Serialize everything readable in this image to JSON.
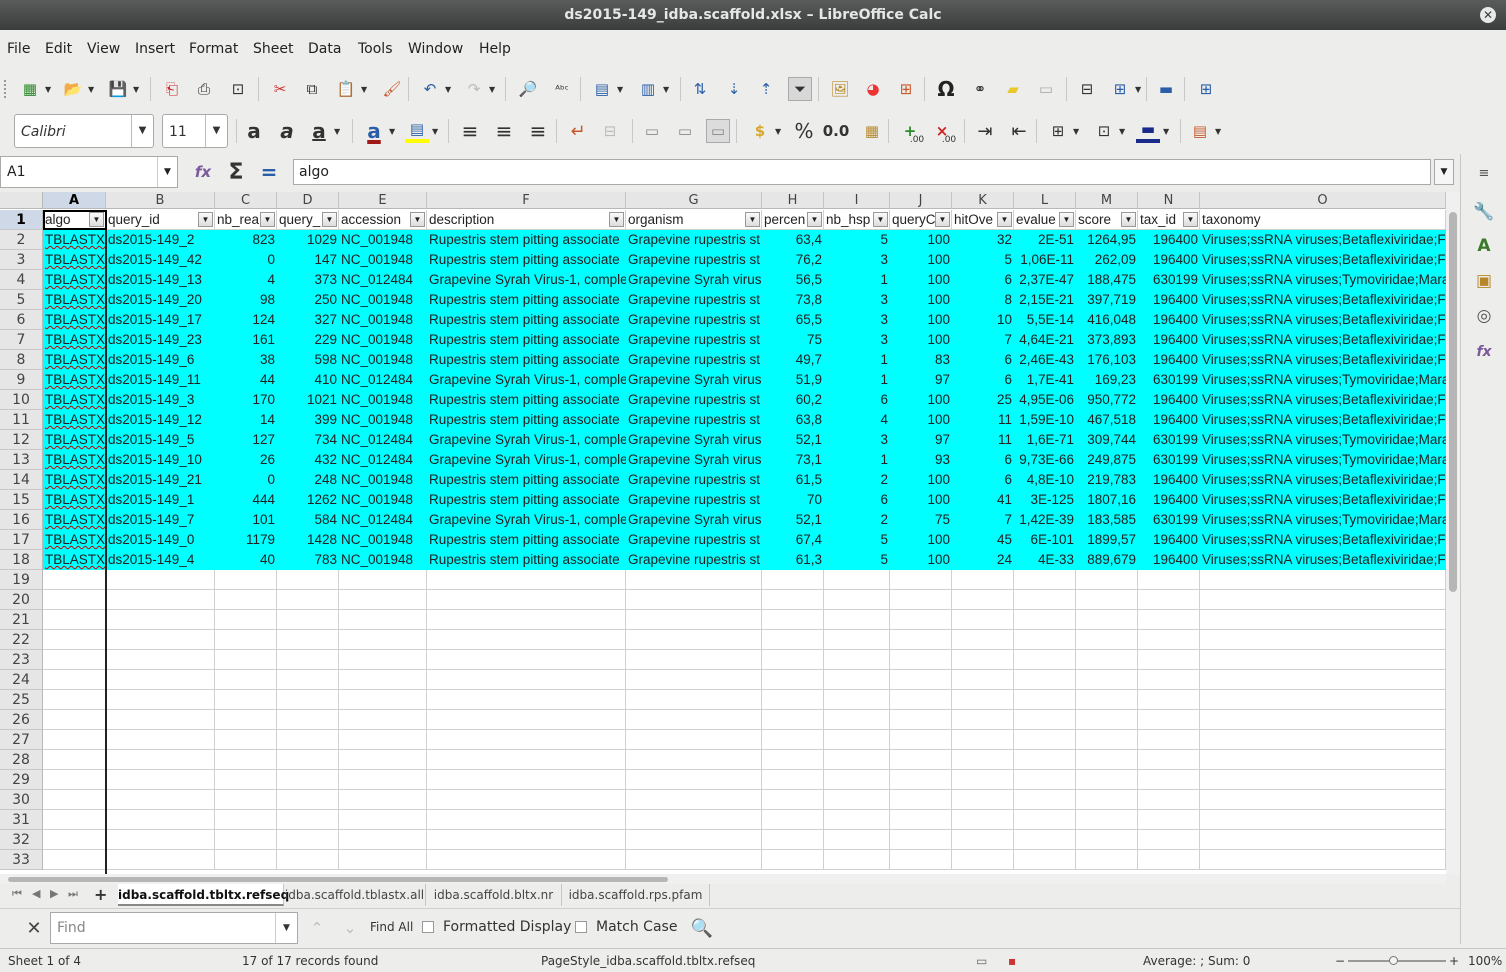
{
  "window": {
    "title": "ds2015-149_idba.scaffold.xlsx – LibreOffice Calc",
    "close_glyph": "✕"
  },
  "menu": [
    "File",
    "Edit",
    "View",
    "Insert",
    "Format",
    "Sheet",
    "Data",
    "Tools",
    "Window",
    "Help"
  ],
  "toolbar": {
    "font_name": "Calibri",
    "font_size": "11",
    "percent_label": "%",
    "number_label": "0.0",
    "omega_label": "Ω",
    "add_decimal_label": ".00",
    "remove_decimal_label": ".00"
  },
  "formula_bar": {
    "name_box": "A1",
    "content": "algo"
  },
  "sheet": {
    "column_letters": [
      "A",
      "B",
      "C",
      "D",
      "E",
      "F",
      "G",
      "H",
      "I",
      "J",
      "K",
      "L",
      "M",
      "N",
      "O"
    ],
    "headers": [
      "algo",
      "query_id",
      "nb_rea",
      "query_",
      "accession",
      "description",
      "organism",
      "percen",
      "nb_hsp",
      "queryC",
      "hitOve",
      "evalue",
      "score",
      "tax_id",
      "taxonomy"
    ],
    "rows": [
      [
        "TBLASTX",
        "ds2015-149_2",
        "823",
        "1029",
        "NC_001948",
        "Rupestris stem pitting associate",
        "Grapevine rupestris st",
        "63,4",
        "5",
        "100",
        "32",
        "2E-51",
        "1264,95",
        "196400",
        "Viruses;ssRNA viruses;Betaflexiviridae;Fo"
      ],
      [
        "TBLASTX",
        "ds2015-149_42",
        "0",
        "147",
        "NC_001948",
        "Rupestris stem pitting associate",
        "Grapevine rupestris st",
        "76,2",
        "3",
        "100",
        "5",
        "1,06E-11",
        "262,09",
        "196400",
        "Viruses;ssRNA viruses;Betaflexiviridae;Fo"
      ],
      [
        "TBLASTX",
        "ds2015-149_13",
        "4",
        "373",
        "NC_012484",
        "Grapevine Syrah Virus-1, comple",
        "Grapevine Syrah virus",
        "56,5",
        "1",
        "100",
        "6",
        "2,37E-47",
        "188,475",
        "630199",
        "Viruses;ssRNA viruses;Tymoviridae;Mara"
      ],
      [
        "TBLASTX",
        "ds2015-149_20",
        "98",
        "250",
        "NC_001948",
        "Rupestris stem pitting associate",
        "Grapevine rupestris st",
        "73,8",
        "3",
        "100",
        "8",
        "2,15E-21",
        "397,719",
        "196400",
        "Viruses;ssRNA viruses;Betaflexiviridae;Fo"
      ],
      [
        "TBLASTX",
        "ds2015-149_17",
        "124",
        "327",
        "NC_001948",
        "Rupestris stem pitting associate",
        "Grapevine rupestris st",
        "65,5",
        "3",
        "100",
        "10",
        "5,5E-14",
        "416,048",
        "196400",
        "Viruses;ssRNA viruses;Betaflexiviridae;Fo"
      ],
      [
        "TBLASTX",
        "ds2015-149_23",
        "161",
        "229",
        "NC_001948",
        "Rupestris stem pitting associate",
        "Grapevine rupestris st",
        "75",
        "3",
        "100",
        "7",
        "4,64E-21",
        "373,893",
        "196400",
        "Viruses;ssRNA viruses;Betaflexiviridae;Fo"
      ],
      [
        "TBLASTX",
        "ds2015-149_6",
        "38",
        "598",
        "NC_001948",
        "Rupestris stem pitting associate",
        "Grapevine rupestris st",
        "49,7",
        "1",
        "83",
        "6",
        "2,46E-43",
        "176,103",
        "196400",
        "Viruses;ssRNA viruses;Betaflexiviridae;Fo"
      ],
      [
        "TBLASTX",
        "ds2015-149_11",
        "44",
        "410",
        "NC_012484",
        "Grapevine Syrah Virus-1, comple",
        "Grapevine Syrah virus",
        "51,9",
        "1",
        "97",
        "6",
        "1,7E-41",
        "169,23",
        "630199",
        "Viruses;ssRNA viruses;Tymoviridae;Mara"
      ],
      [
        "TBLASTX",
        "ds2015-149_3",
        "170",
        "1021",
        "NC_001948",
        "Rupestris stem pitting associate",
        "Grapevine rupestris st",
        "60,2",
        "6",
        "100",
        "25",
        "4,95E-06",
        "950,772",
        "196400",
        "Viruses;ssRNA viruses;Betaflexiviridae;Fo"
      ],
      [
        "TBLASTX",
        "ds2015-149_12",
        "14",
        "399",
        "NC_001948",
        "Rupestris stem pitting associate",
        "Grapevine rupestris st",
        "63,8",
        "4",
        "100",
        "11",
        "1,59E-10",
        "467,518",
        "196400",
        "Viruses;ssRNA viruses;Betaflexiviridae;Fo"
      ],
      [
        "TBLASTX",
        "ds2015-149_5",
        "127",
        "734",
        "NC_012484",
        "Grapevine Syrah Virus-1, comple",
        "Grapevine Syrah virus",
        "52,1",
        "3",
        "97",
        "11",
        "1,6E-71",
        "309,744",
        "630199",
        "Viruses;ssRNA viruses;Tymoviridae;Mara"
      ],
      [
        "TBLASTX",
        "ds2015-149_10",
        "26",
        "432",
        "NC_012484",
        "Grapevine Syrah Virus-1, comple",
        "Grapevine Syrah virus",
        "73,1",
        "1",
        "93",
        "6",
        "9,73E-66",
        "249,875",
        "630199",
        "Viruses;ssRNA viruses;Tymoviridae;Mara"
      ],
      [
        "TBLASTX",
        "ds2015-149_21",
        "0",
        "248",
        "NC_001948",
        "Rupestris stem pitting associate",
        "Grapevine rupestris st",
        "61,5",
        "2",
        "100",
        "6",
        "4,8E-10",
        "219,783",
        "196400",
        "Viruses;ssRNA viruses;Betaflexiviridae;Fo"
      ],
      [
        "TBLASTX",
        "ds2015-149_1",
        "444",
        "1262",
        "NC_001948",
        "Rupestris stem pitting associate",
        "Grapevine rupestris st",
        "70",
        "6",
        "100",
        "41",
        "3E-125",
        "1807,16",
        "196400",
        "Viruses;ssRNA viruses;Betaflexiviridae;Fo"
      ],
      [
        "TBLASTX",
        "ds2015-149_7",
        "101",
        "584",
        "NC_012484",
        "Grapevine Syrah Virus-1, comple",
        "Grapevine Syrah virus",
        "52,1",
        "2",
        "75",
        "7",
        "1,42E-39",
        "183,585",
        "630199",
        "Viruses;ssRNA viruses;Tymoviridae;Mara"
      ],
      [
        "TBLASTX",
        "ds2015-149_0",
        "1179",
        "1428",
        "NC_001948",
        "Rupestris stem pitting associate",
        "Grapevine rupestris st",
        "67,4",
        "5",
        "100",
        "45",
        "6E-101",
        "1899,57",
        "196400",
        "Viruses;ssRNA viruses;Betaflexiviridae;Fo"
      ],
      [
        "TBLASTX",
        "ds2015-149_4",
        "40",
        "783",
        "NC_001948",
        "Rupestris stem pitting associate",
        "Grapevine rupestris st",
        "61,3",
        "5",
        "100",
        "24",
        "4E-33",
        "889,679",
        "196400",
        "Viruses;ssRNA viruses;Betaflexiviridae;Fo"
      ]
    ],
    "numeric_columns": [
      2,
      3,
      7,
      8,
      9,
      10,
      11,
      12,
      13
    ],
    "last_row_number": 33,
    "highlight_color": "#00ffff"
  },
  "tabs": [
    "idba.scaffold.tbltx.refseq",
    "idba.scaffold.tblastx.all",
    "idba.scaffold.bltx.nr",
    "idba.scaffold.rps.pfam"
  ],
  "active_tab": 0,
  "add_sheet_label": "+",
  "findbar": {
    "placeholder": "Find",
    "find_all": "Find All",
    "formatted_display": "Formatted Display",
    "match_case": "Match Case"
  },
  "status": {
    "sheet": "Sheet 1 of 4",
    "records": "17 of 17 records found",
    "page_style": "PageStyle_idba.scaffold.tbltx.refseq",
    "sum": "Average: ; Sum: 0",
    "zoom": "100%"
  }
}
